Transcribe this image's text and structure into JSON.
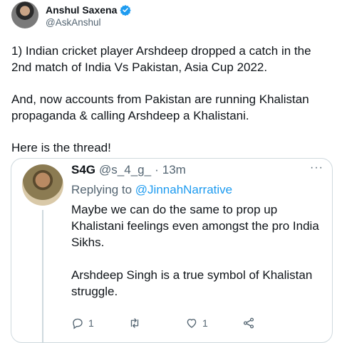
{
  "author": {
    "name": "Anshul Saxena",
    "handle": "@AskAnshul"
  },
  "tweet": {
    "paragraphs": [
      "1) Indian cricket player Arshdeep dropped a catch in the 2nd match of India Vs Pakistan, Asia Cup 2022.",
      "And, now accounts from Pakistan are running Khalistan propaganda & calling Arshdeep a Khalistani.",
      "Here is the thread!"
    ]
  },
  "quote": {
    "name": "S4G",
    "handle": "@s_4_g_",
    "dot": "·",
    "time": "13m",
    "more": "···",
    "replying_prefix": "Replying to",
    "replying_to": "@JinnahNarrative",
    "paragraphs": [
      "Maybe we can do the same to prop up Khalistani feelings even amongst the pro India Sikhs.",
      "Arshdeep Singh is a true symbol of Khalistan struggle."
    ],
    "actions": {
      "reply_count": "1",
      "retweet_count": "",
      "like_count": "1"
    }
  },
  "colors": {
    "verified": "#1d9bf0",
    "link": "#1d9bf0",
    "secondary": "#536471",
    "border": "#cfd9de"
  }
}
